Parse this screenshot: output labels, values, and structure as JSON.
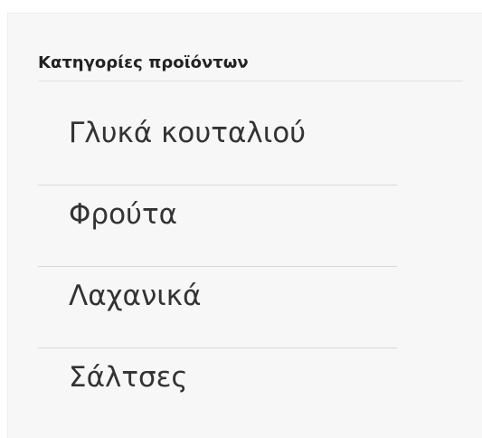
{
  "widget": {
    "title": "Κατηγορίες προϊόντων",
    "categories": [
      {
        "label": "Γλυκά κουταλιού"
      },
      {
        "label": "Φρούτα"
      },
      {
        "label": "Λαχανικά"
      },
      {
        "label": "Σάλτσες"
      }
    ]
  }
}
